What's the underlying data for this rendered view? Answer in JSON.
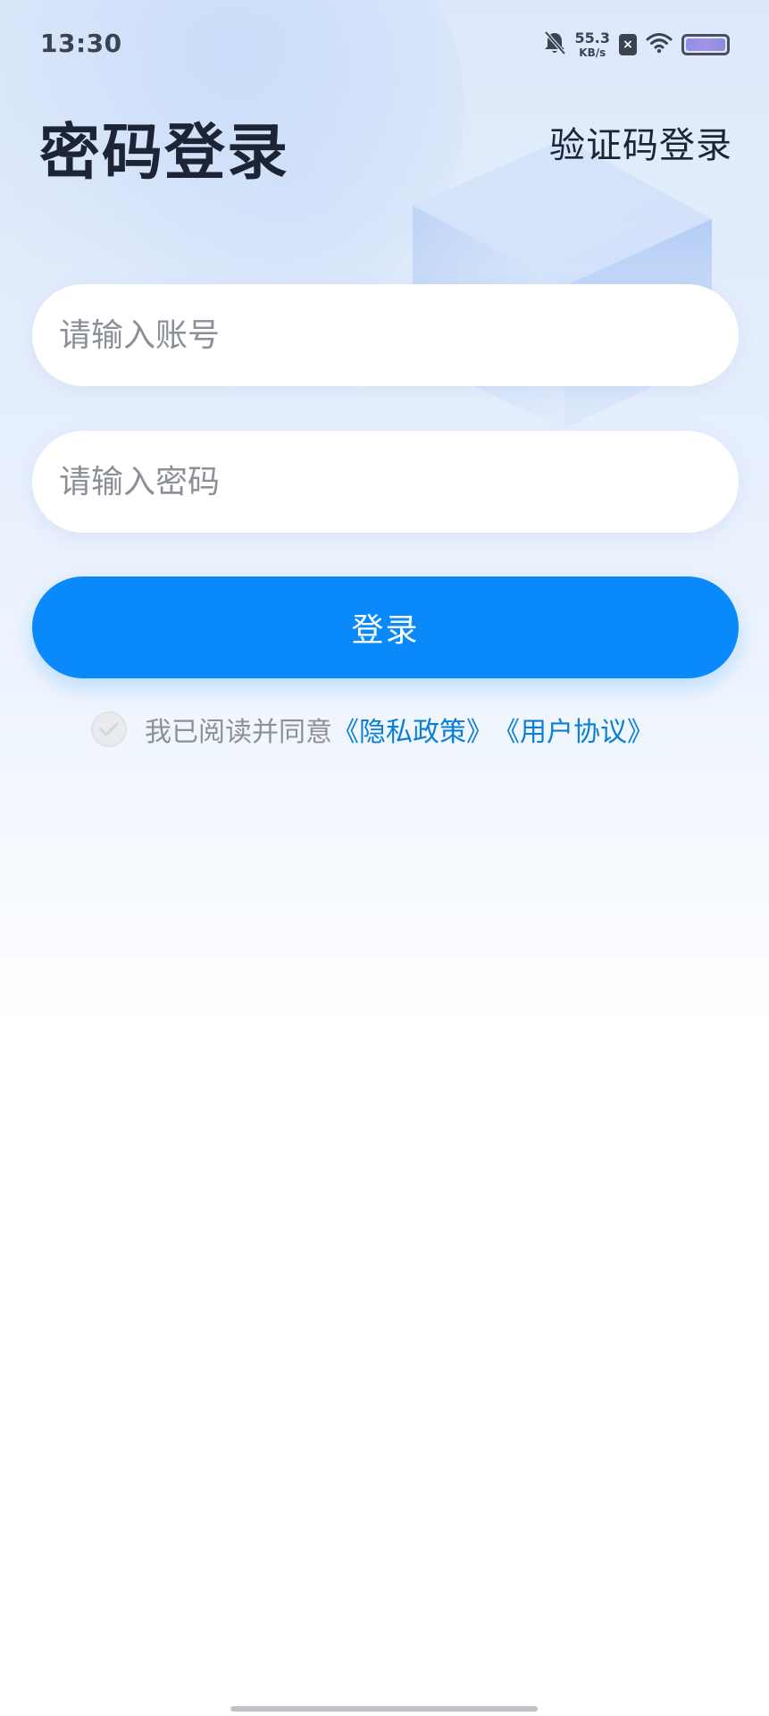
{
  "status_bar": {
    "time": "13:30",
    "net_speed_value": "55.3",
    "net_speed_unit": "KB/s",
    "sim_badge": "×",
    "icons": [
      "bell-off-icon",
      "sim-no-service-icon",
      "wifi-icon",
      "battery-icon"
    ]
  },
  "header": {
    "title": "密码登录",
    "alt_login": "验证码登录"
  },
  "form": {
    "account_placeholder": "请输入账号",
    "password_placeholder": "请输入密码",
    "account_value": "",
    "password_value": "",
    "submit_label": "登录"
  },
  "agreement": {
    "checked": false,
    "text": "我已阅读并同意",
    "privacy_link": "《隐私政策》",
    "terms_link": "《用户协议》"
  },
  "colors": {
    "primary": "#0a89fb",
    "link": "#0a7fd6",
    "title": "#1c2436",
    "placeholder": "#8a8f98"
  }
}
